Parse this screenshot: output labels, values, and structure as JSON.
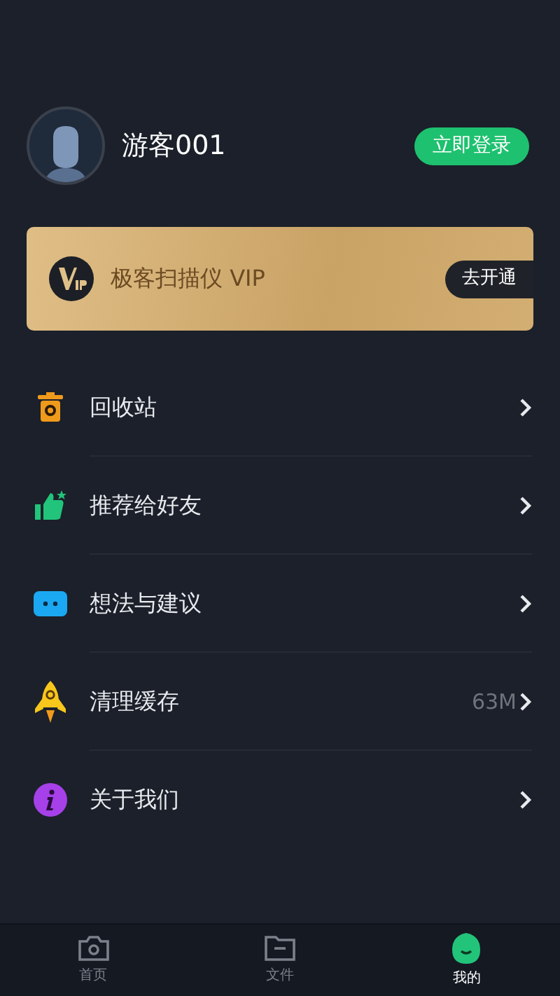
{
  "profile": {
    "name": "游客001",
    "login_button": "立即登录"
  },
  "vip": {
    "title": "极客扫描仪 VIP",
    "button": "去开通"
  },
  "menu": [
    {
      "kind": "trash",
      "label": "回收站"
    },
    {
      "kind": "thumb",
      "label": "推荐给好友"
    },
    {
      "kind": "chat",
      "label": "想法与建议"
    },
    {
      "kind": "rocket",
      "label": "清理缓存",
      "value": "63M"
    },
    {
      "kind": "info",
      "label": "关于我们"
    }
  ],
  "tabs": [
    {
      "kind": "camera",
      "label": "首页",
      "selected": false
    },
    {
      "kind": "folder",
      "label": "文件",
      "selected": false
    },
    {
      "kind": "leaf",
      "label": "我的",
      "selected": true
    }
  ]
}
